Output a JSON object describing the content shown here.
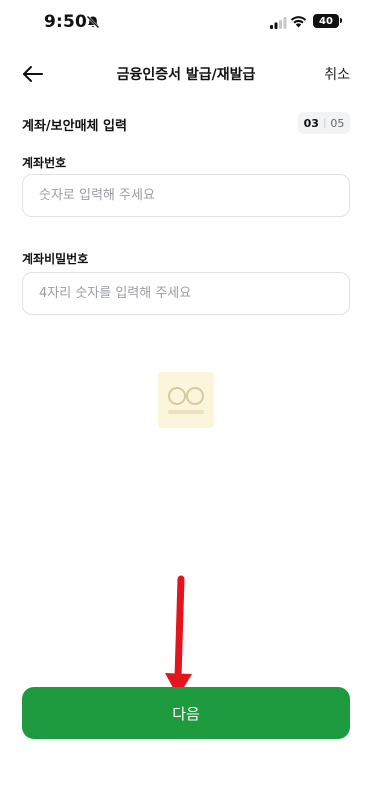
{
  "status_bar": {
    "time": "9:50",
    "battery": "40",
    "icons": [
      "bell-slash-icon",
      "cellular-signal-icon",
      "wifi-icon",
      "battery-icon"
    ]
  },
  "nav": {
    "title": "금융인증서 발급/재발급",
    "cancel_label": "취소",
    "back_icon": "arrow-left-icon"
  },
  "section": {
    "title": "계좌/보안매체 입력",
    "step_current": "03",
    "step_total": "05"
  },
  "form": {
    "account_number": {
      "label": "계좌번호",
      "placeholder": "숫자로 입력해 주세요",
      "value": ""
    },
    "account_password": {
      "label": "계좌비밀번호",
      "placeholder": "4자리 숫자를 입력해 주세요",
      "value": ""
    }
  },
  "footer": {
    "next_label": "다음"
  },
  "colors": {
    "primary": "#1f9b3f",
    "annotation_arrow": "#e3141c",
    "input_border": "#e0e2e6",
    "placeholder": "#9a9da3"
  }
}
